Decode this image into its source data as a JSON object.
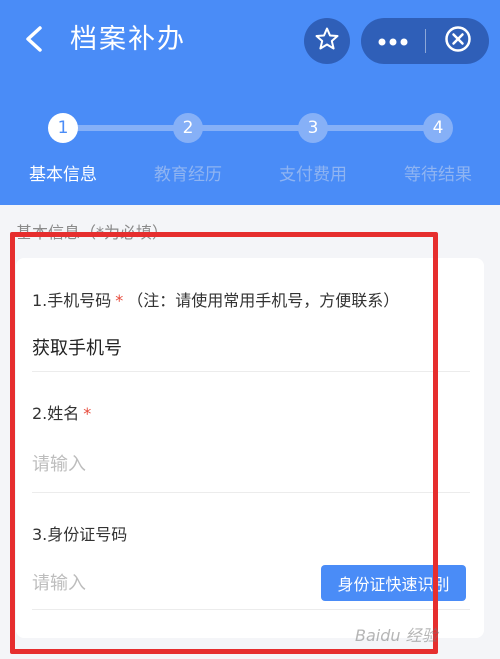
{
  "header": {
    "title": "档案补办",
    "icons": {
      "back": "back-arrow-icon",
      "star": "star-icon",
      "more": "more-dots-icon",
      "close": "close-circle-icon"
    }
  },
  "steps": [
    {
      "number": "1",
      "label": "基本信息",
      "active": true
    },
    {
      "number": "2",
      "label": "教育经历",
      "active": false
    },
    {
      "number": "3",
      "label": "支付费用",
      "active": false
    },
    {
      "number": "4",
      "label": "等待结果",
      "active": false
    }
  ],
  "section_title": "基本信息（*为必填）",
  "form": {
    "phone_label": "1.手机号码",
    "phone_note": "（注：请使用常用手机号，方便联系）",
    "phone_value": "获取手机号",
    "name_label": "2.姓名",
    "name_placeholder": "请输入",
    "id_label": "3.身份证号码",
    "id_placeholder": "请输入",
    "id_button": "身份证快速识别",
    "required_mark": "*"
  },
  "watermark": "Baidu 经验",
  "colors": {
    "primary": "#4a8cf7",
    "required": "#e74a3b",
    "annotation": "#e62e2e"
  }
}
